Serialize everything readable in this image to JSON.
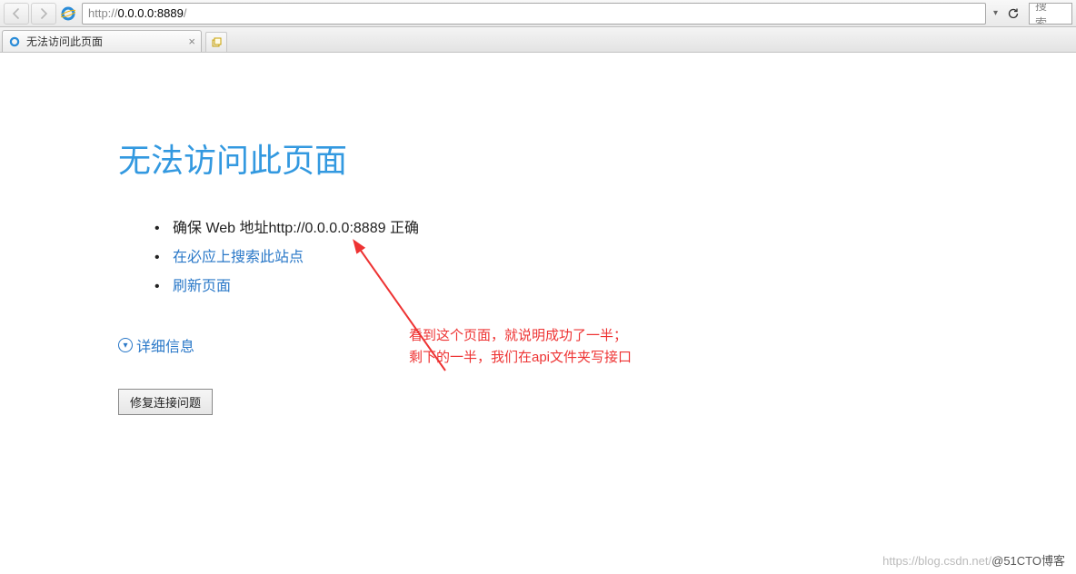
{
  "browser": {
    "url_protocol": "http://",
    "url_host": "0.0.0.0:8889",
    "url_path": "/",
    "search_placeholder": "搜索..."
  },
  "tab": {
    "title": "无法访问此页面"
  },
  "error": {
    "heading": "无法访问此页面",
    "suggestions": {
      "check_address": "确保 Web 地址http://0.0.0.0:8889 正确",
      "search_bing": "在必应上搜索此站点",
      "refresh": "刷新页面"
    },
    "details_label": "详细信息",
    "fix_button": "修复连接问题"
  },
  "annotation": {
    "line1": "看到这个页面，就说明成功了一半；",
    "line2": "剩下的一半，我们在api文件夹写接口"
  },
  "watermark": {
    "faint": "https://blog.csdn.net/",
    "dark": "@51CTO博客"
  }
}
